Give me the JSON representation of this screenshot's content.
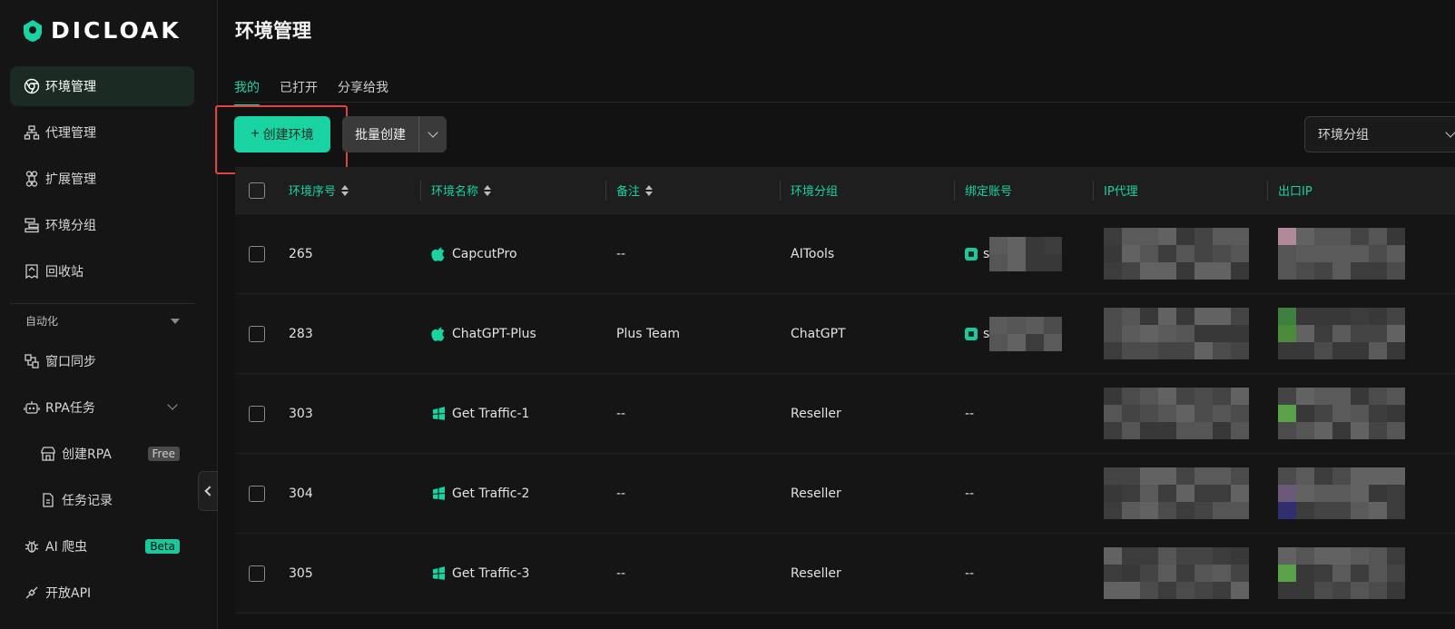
{
  "brand": {
    "name": "DICLOAK"
  },
  "sidebar": {
    "items": [
      {
        "label": "环境管理",
        "icon": "chrome-icon",
        "active": true
      },
      {
        "label": "代理管理",
        "icon": "network-icon"
      },
      {
        "label": "扩展管理",
        "icon": "command-icon"
      },
      {
        "label": "环境分组",
        "icon": "group-icon"
      },
      {
        "label": "回收站",
        "icon": "recycle-icon"
      }
    ],
    "section": "自动化",
    "auto_items": [
      {
        "label": "窗口同步",
        "icon": "sync-window-icon"
      },
      {
        "label": "RPA任务",
        "icon": "robot-icon"
      },
      {
        "label": "创建RPA",
        "icon": "store-icon",
        "badge": "Free"
      },
      {
        "label": "任务记录",
        "icon": "document-icon"
      },
      {
        "label": "AI 爬虫",
        "icon": "bug-icon",
        "badge": "Beta"
      },
      {
        "label": "开放API",
        "icon": "api-icon"
      }
    ]
  },
  "main": {
    "title": "环境管理",
    "tabs": [
      "我的",
      "已打开",
      "分享给我"
    ],
    "create_label": "创建环境",
    "batch_label": "批量创建",
    "group_select": "环境分组"
  },
  "table": {
    "columns": [
      "环境序号",
      "环境名称",
      "备注",
      "环境分组",
      "绑定账号",
      "IP代理",
      "出口IP"
    ],
    "rows": [
      {
        "id": "265",
        "name": "CapcutPro",
        "os": "apple-icon",
        "note": "--",
        "group": "AITools",
        "account": "s"
      },
      {
        "id": "283",
        "name": "ChatGPT-Plus",
        "os": "apple-icon",
        "note": "Plus Team",
        "group": "ChatGPT",
        "account": "s"
      },
      {
        "id": "303",
        "name": "Get Traffic-1",
        "os": "windows-icon",
        "note": "--",
        "group": "Reseller",
        "account": "--"
      },
      {
        "id": "304",
        "name": "Get Traffic-2",
        "os": "windows-icon",
        "note": "--",
        "group": "Reseller",
        "account": "--"
      },
      {
        "id": "305",
        "name": "Get Traffic-3",
        "os": "windows-icon",
        "note": "--",
        "group": "Reseller",
        "account": "--"
      }
    ]
  },
  "colors": {
    "accent": "#19d3a2",
    "highlight": "#e0443f",
    "bg": "#121212"
  }
}
